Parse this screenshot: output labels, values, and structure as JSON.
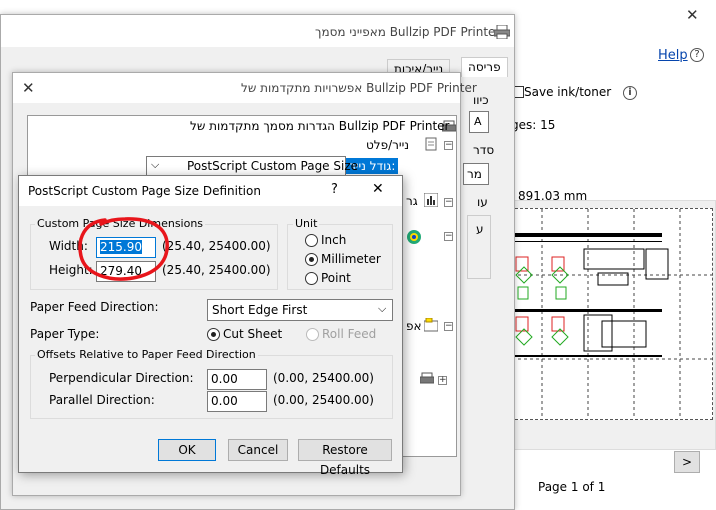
{
  "background_window": {
    "help_label": "Help",
    "help_icon": "question-circle-icon",
    "save_ink_label": "Save ink/toner",
    "info_icon": "info-icon",
    "pages_label": "ges: 15",
    "dimension_label": "891.03 mm",
    "next_label": ">",
    "page_indicator": "Page 1 of 1",
    "side_label_1": "כיוו",
    "side_label_2": "סדר",
    "side_label_3": "מר",
    "side_label_4": "עו",
    "side_label_5": "ע"
  },
  "doc_window": {
    "title": "מאפייני מסמך Bullzip PDF Printer",
    "tabs": [
      "פריסה",
      "נייר/איכות"
    ]
  },
  "adv_window": {
    "title": "אפשרויות מתקדמות של Bullzip PDF Printer",
    "tree": {
      "root": "הגדרות מסמך מתקדמות של Bullzip PDF Printer",
      "paper_output": "נייר/פלט",
      "paper_size_label": "גודל נייר:",
      "paper_size_value": "PostScript Custom Page Size",
      "graphics_partial": "גר",
      "options_partial": "אפ"
    }
  },
  "ps_dialog": {
    "title": "PostScript Custom Page Size Definition",
    "help_glyph": "?",
    "close_glyph": "✕",
    "dimensions_group": "Custom Page Size Dimensions",
    "width_label": "Width:",
    "width_value": "215.90",
    "width_range": "(25.40, 25400.00)",
    "height_label": "Height:",
    "height_value": "279.40",
    "height_range": "(25.40, 25400.00)",
    "unit_group": "Unit",
    "unit_options": [
      "Inch",
      "Millimeter",
      "Point"
    ],
    "unit_selected": "Millimeter",
    "feed_direction_label": "Paper Feed Direction:",
    "feed_direction_value": "Short Edge First",
    "paper_type_label": "Paper Type:",
    "paper_type_options": [
      "Cut Sheet",
      "Roll Feed"
    ],
    "paper_type_selected": "Cut Sheet",
    "offsets_group": "Offsets Relative to Paper Feed Direction",
    "perpendicular_label": "Perpendicular Direction:",
    "perpendicular_value": "0.00",
    "perpendicular_range": "(0.00, 25400.00)",
    "parallel_label": "Parallel Direction:",
    "parallel_value": "0.00",
    "parallel_range": "(0.00, 25400.00)",
    "ok_label": "OK",
    "cancel_label": "Cancel",
    "restore_label": "Restore Defaults"
  },
  "colors": {
    "accent": "#0078d7",
    "annotation_circle": "#e8151b",
    "link": "#0645ad"
  }
}
